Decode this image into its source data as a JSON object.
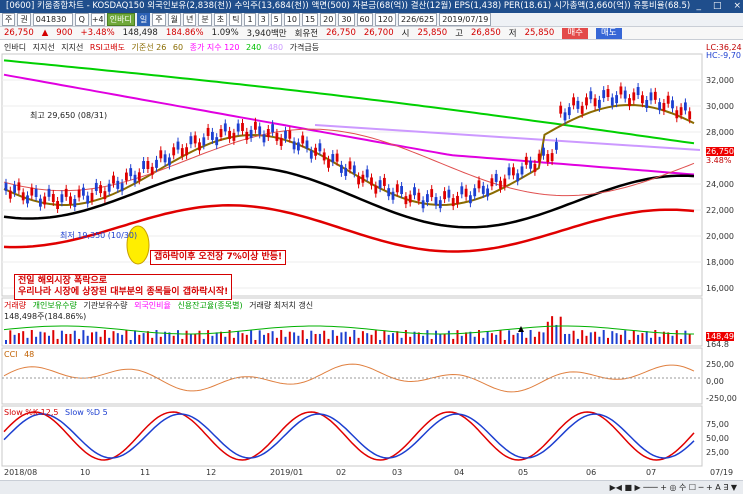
{
  "window": {
    "title": "[0600] 키움종합차트 - KOSDAQ150 외국인보유(2,838(천)) 수익주(13,684(천)) 액면(500) 자본금(68(억)) 결산(12월) EPS(1,438) PER(18.61) 시가총액(3,660(억)) 유통비율(68.5)",
    "controls": [
      "_",
      "□",
      "×"
    ]
  },
  "toolbar": {
    "items": [
      "주",
      "권",
      "041830",
      "Q",
      "+4",
      "인바디",
      "일",
      "주",
      "월",
      "년",
      "분",
      "초",
      "틱",
      "1",
      "3",
      "5",
      "10",
      "15",
      "20",
      "30",
      "60",
      "120",
      "226/625",
      "2019/07/19"
    ],
    "stock_code": "041830",
    "stock_name": "인바디",
    "count": "226/625",
    "date": "2019/07/19"
  },
  "pricebar": {
    "price": "26,750",
    "change_sign": "▲",
    "change": "900",
    "pct": "+3.48%",
    "volume": "148,498",
    "volume_pct": "184.86%",
    "amount": "1.09%",
    "trade_value": "3,940백만",
    "prev_label": "회유전",
    "v1": "26,750",
    "v2": "26,700",
    "open_label": "시",
    "open": "25,850",
    "high_label": "고",
    "high": "26,850",
    "low_label": "저",
    "low": "25,850",
    "buy": "매수",
    "sell": "매도"
  },
  "main_legend": {
    "items": [
      "인바디",
      "지지선",
      "지지선",
      "RSI고배도",
      "기준선 26",
      "60",
      "종가 지수 120",
      "240",
      "480",
      "가격급등"
    ],
    "colors": [
      "#222222",
      "#222222",
      "#222222",
      "#c00000",
      "#8a6b00",
      "#8a6b00",
      "#ff00ff",
      "#00c000",
      "#cc99ff",
      "#222222"
    ]
  },
  "annotations": {
    "high": "최고 29,650 (08/31)",
    "low": "최저 19,350 (10/30)",
    "box1": "갭하락이후 오전장 7%이상 반등!",
    "box2_line1": "전일 해외시장 폭락으로",
    "box2_line2": "우리나라 시장에 상장된 대부분의 종목들이 갭하락시작!"
  },
  "y_axis_main": [
    "32,000",
    "30,000",
    "28,000",
    "26,000",
    "24,000",
    "22,000",
    "20,000",
    "18,000",
    "16,000"
  ],
  "y_axis_vol": [
    "148,49",
    "164.8"
  ],
  "y_axis_cci": [
    "250,00",
    "0,00",
    "-250,00"
  ],
  "y_axis_slow": [
    "75,00",
    "50,00",
    "25,00"
  ],
  "right_labels": {
    "lc": "LC:36,24",
    "hc": "HC:-9,70",
    "cur": "26,750",
    "pct": "3.48%"
  },
  "volume_legend": {
    "items": [
      "거래량",
      "개인보유수량",
      "기관보유수량",
      "외국인비율",
      "신용잔고율(종목별)",
      "거래량 최저치 갱신"
    ],
    "value": "148,498주(184.86%)"
  },
  "cci_legend": {
    "name": "CCI",
    "value": "48"
  },
  "slow_legend": {
    "k": "Slow %K 12,5",
    "d": "Slow %D 5"
  },
  "x_axis": [
    "2018/08",
    "10",
    "11",
    "12",
    "2019/01",
    "02",
    "03",
    "04",
    "05",
    "06",
    "07",
    "07/19"
  ],
  "status": {
    "left": "",
    "right": "▶◀ ■ ▶ ─── + ◎ 수 ☐ ─ + A ∃ ▼"
  }
}
